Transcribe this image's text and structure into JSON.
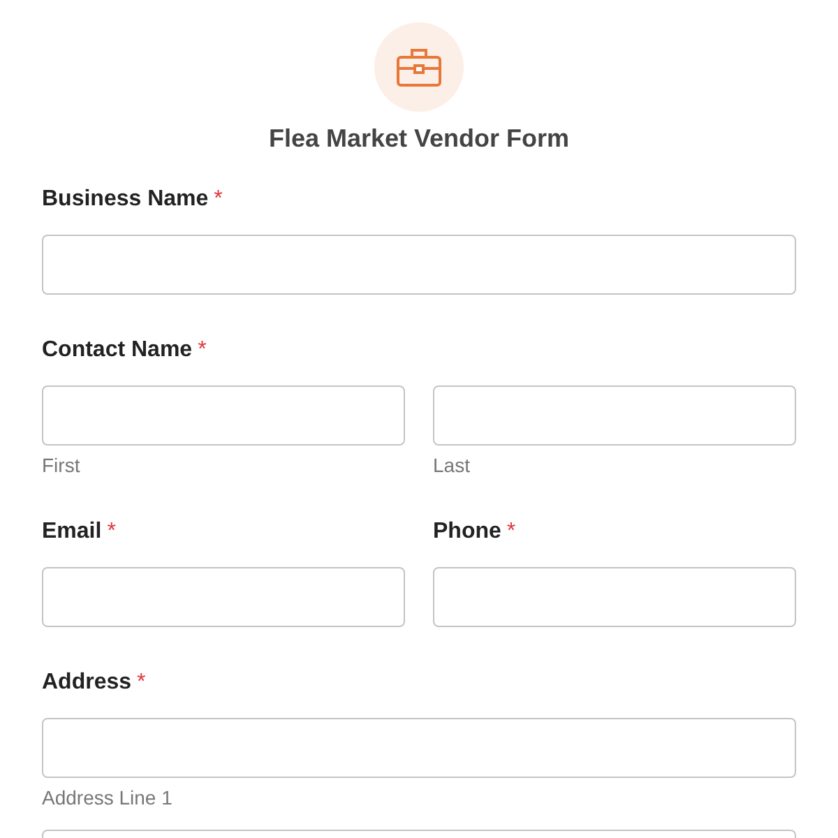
{
  "form": {
    "title": "Flea Market Vendor Form",
    "required_mark": "*"
  },
  "sections": [
    {
      "kind": "single",
      "label": "Business Name",
      "required": true
    },
    {
      "kind": "split",
      "label": "Contact Name",
      "required": true,
      "sublabels": [
        "First",
        "Last"
      ]
    },
    {
      "kind": "pair",
      "fields": [
        {
          "label": "Email",
          "required": true
        },
        {
          "label": "Phone",
          "required": true
        }
      ]
    },
    {
      "kind": "address",
      "label": "Address",
      "required": true,
      "sublabels": [
        "Address Line 1"
      ]
    }
  ]
}
